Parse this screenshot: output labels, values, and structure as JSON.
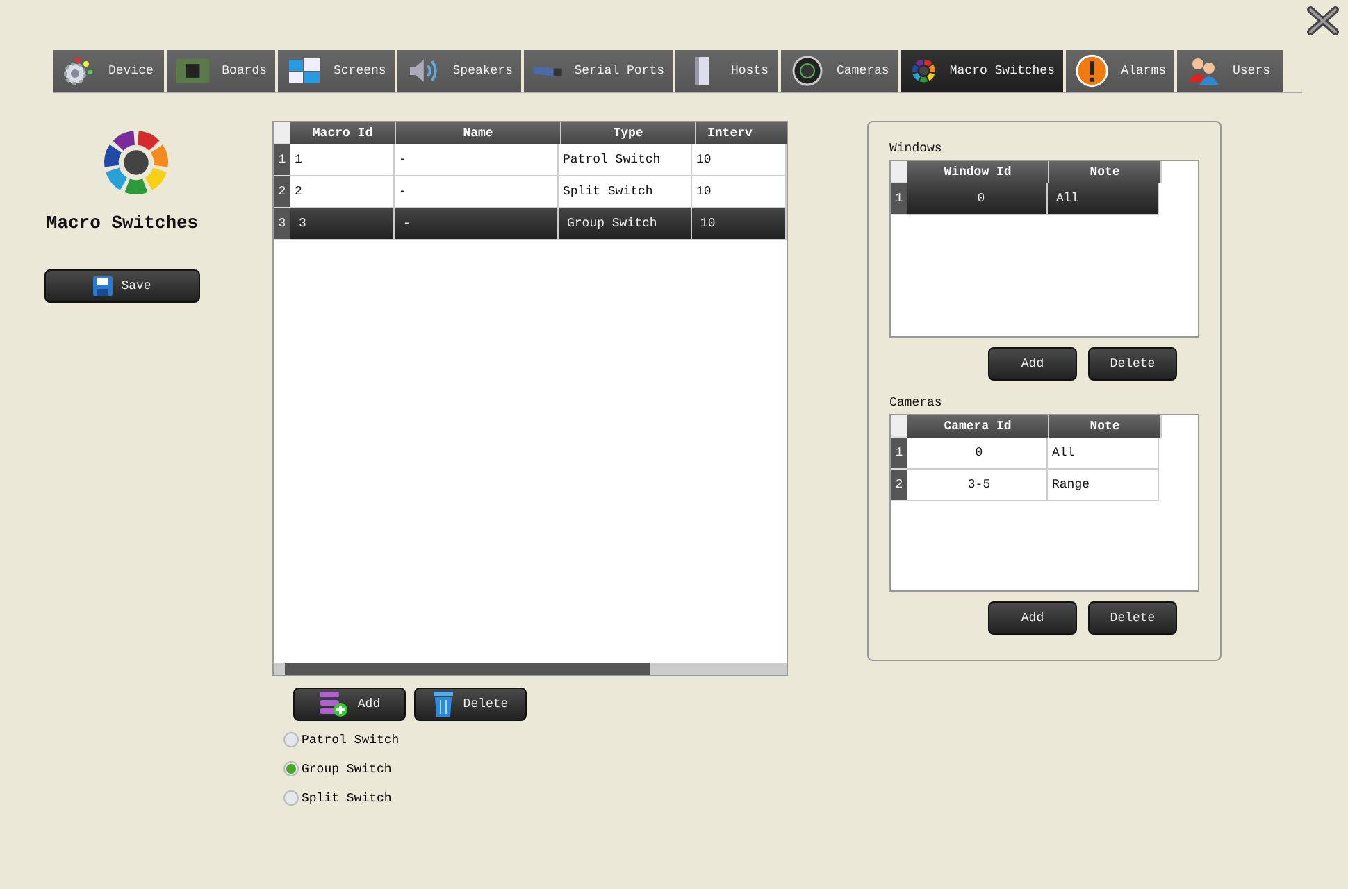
{
  "tabs": [
    {
      "label": "Device",
      "selected": false
    },
    {
      "label": "Boards",
      "selected": false
    },
    {
      "label": "Screens",
      "selected": false
    },
    {
      "label": "Speakers",
      "selected": false
    },
    {
      "label": "Serial Ports",
      "selected": false
    },
    {
      "label": "Hosts",
      "selected": false
    },
    {
      "label": "Cameras",
      "selected": false
    },
    {
      "label": "Macro Switches",
      "selected": true
    },
    {
      "label": "Alarms",
      "selected": false
    },
    {
      "label": "Users",
      "selected": false
    }
  ],
  "sidebar": {
    "title": "Macro Switches",
    "save_button": "Save"
  },
  "macro_table": {
    "columns": [
      "Macro Id",
      "Name",
      "Type",
      "Interv"
    ],
    "rows": [
      {
        "number": "1",
        "cells": [
          "1",
          "-",
          "Patrol Switch",
          "10"
        ],
        "selected": false
      },
      {
        "number": "2",
        "cells": [
          "2",
          "-",
          "Split Switch",
          "10"
        ],
        "selected": false
      },
      {
        "number": "3",
        "cells": [
          "3",
          "-",
          "Group Switch",
          "10"
        ],
        "selected": true
      }
    ]
  },
  "macro_buttons": [
    "Add",
    "Delete"
  ],
  "switch_types": [
    {
      "label": "Patrol Switch",
      "selected": false
    },
    {
      "label": "Group Switch",
      "selected": true
    },
    {
      "label": "Split Switch",
      "selected": false
    }
  ],
  "windows": {
    "label": "Windows",
    "columns": [
      "Window Id",
      "Note"
    ],
    "rows": [
      {
        "number": "1",
        "cells": [
          "0",
          "All"
        ],
        "selected": true
      }
    ],
    "buttons": [
      "Add",
      "Delete"
    ]
  },
  "cameras": {
    "label": "Cameras",
    "columns": [
      "Camera Id",
      "Note"
    ],
    "rows": [
      {
        "number": "1",
        "cells": [
          "0",
          "All"
        ],
        "selected": false
      },
      {
        "number": "2",
        "cells": [
          "3-5",
          "Range"
        ],
        "selected": false
      }
    ],
    "buttons": [
      "Add",
      "Delete"
    ]
  }
}
